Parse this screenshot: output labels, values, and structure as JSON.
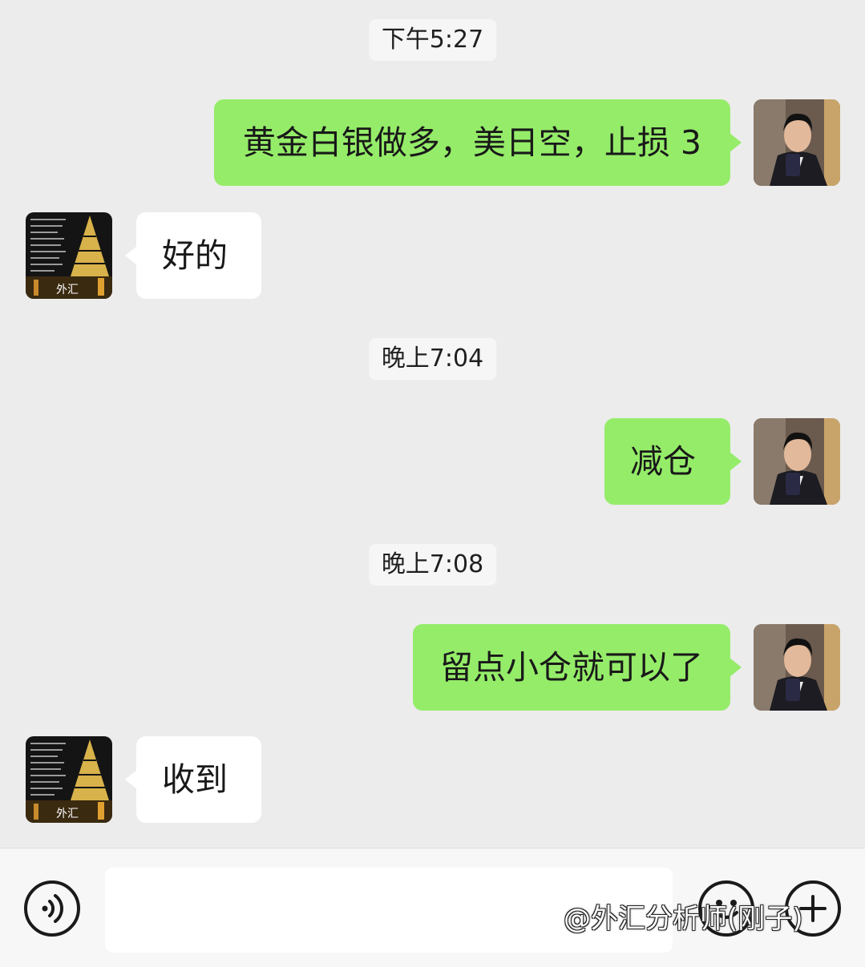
{
  "chat": {
    "timestamps": [
      "下午5:27",
      "晚上7:04",
      "晚上7:08"
    ],
    "messages": [
      {
        "direction": "out",
        "text": "黄金白银做多，美日空，止损 3"
      },
      {
        "direction": "in",
        "text": "好的"
      },
      {
        "direction": "out",
        "text": "减仓"
      },
      {
        "direction": "out",
        "text": "留点小仓就可以了"
      },
      {
        "direction": "in",
        "text": "收到"
      }
    ],
    "contact_avatar_text": "外汇"
  },
  "input_bar": {
    "voice_icon": "voice-icon",
    "emoji_icon": "emoji-icon",
    "add_icon": "plus-icon",
    "input_value": ""
  },
  "watermark": "@外汇分析师(刚子)",
  "colors": {
    "outgoing_bubble": "#95ec69",
    "incoming_bubble": "#ffffff",
    "background": "#ececec"
  }
}
